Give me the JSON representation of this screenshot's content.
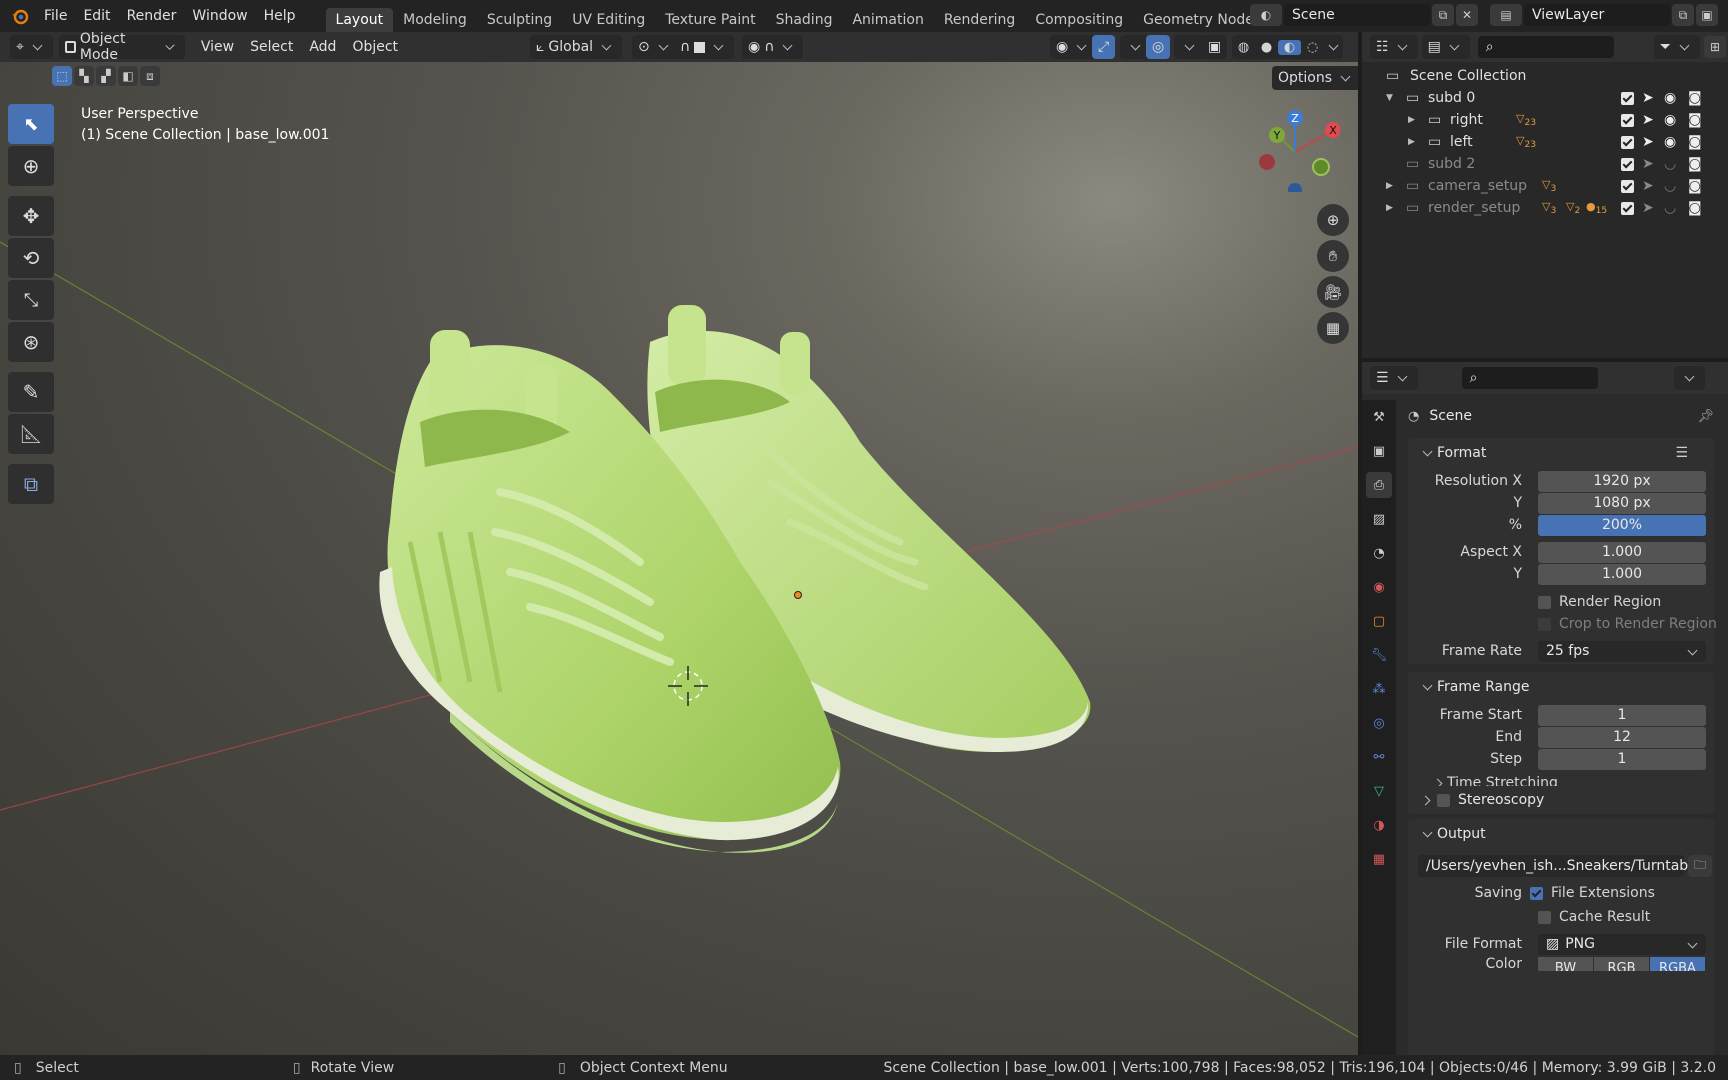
{
  "app": {
    "name": "Blender",
    "version": "3.2.0"
  },
  "menus": [
    "File",
    "Edit",
    "Render",
    "Window",
    "Help"
  ],
  "workspaces": [
    "Layout",
    "Modeling",
    "Sculpting",
    "UV Editing",
    "Texture Paint",
    "Shading",
    "Animation",
    "Rendering",
    "Compositing",
    "Geometry Nodes"
  ],
  "active_workspace": "Layout",
  "scene": {
    "name": "Scene",
    "view_layer": "ViewLayer"
  },
  "viewport_header": {
    "mode": "Object Mode",
    "menus": [
      "View",
      "Select",
      "Add",
      "Object"
    ],
    "transform_orientation": "Global",
    "options_label": "Options"
  },
  "viewport": {
    "view_name": "User Perspective",
    "context": "(1) Scene Collection | base_low.001",
    "gizmo": {
      "x": "X",
      "y": "Y",
      "z": "Z"
    },
    "colors": {
      "shoe": "#b9e07c",
      "sole": "#e6ecd6",
      "x_axis": "#c0484c",
      "y_axis": "#6b8f2e"
    }
  },
  "outliner": {
    "root": "Scene Collection",
    "items": [
      {
        "name": "subd 0",
        "expanded": true,
        "enabled": true
      },
      {
        "name": "right",
        "badge": "23",
        "enabled": true
      },
      {
        "name": "left",
        "badge": "23",
        "enabled": true
      },
      {
        "name": "subd 2",
        "enabled": true,
        "dim": true
      },
      {
        "name": "camera_setup",
        "badge": "3",
        "enabled": true,
        "dim": true
      },
      {
        "name": "render_setup",
        "badge": "3",
        "badge2": "2",
        "badge3": "15",
        "enabled": true,
        "dim": true
      }
    ]
  },
  "properties": {
    "context": "Scene",
    "format": {
      "title": "Format",
      "resolution_x_label": "Resolution X",
      "resolution_x": "1920 px",
      "y_label": "Y",
      "resolution_y": "1080 px",
      "percent_label": "%",
      "percent": "200%",
      "percent_fraction": 1.0,
      "aspect_x_label": "Aspect X",
      "aspect_x": "1.000",
      "aspect_y": "1.000",
      "render_region": "Render Region",
      "render_region_on": false,
      "crop": "Crop to Render Region",
      "crop_on": false,
      "frame_rate_label": "Frame Rate",
      "frame_rate": "25 fps"
    },
    "frame_range": {
      "title": "Frame Range",
      "start_label": "Frame Start",
      "start": "1",
      "end_label": "End",
      "end": "12",
      "step_label": "Step",
      "step": "1",
      "time_stretching": "Time Stretching"
    },
    "stereoscopy": "Stereoscopy",
    "output": {
      "title": "Output",
      "path": "/Users/yevhen_ish...Sneakers/Turntable/",
      "saving_label": "Saving",
      "file_extensions": "File Extensions",
      "file_extensions_on": true,
      "cache_result": "Cache Result",
      "cache_result_on": false,
      "file_format_label": "File Format",
      "file_format": "PNG",
      "color_label": "Color",
      "color_options": [
        "BW",
        "RGB",
        "RGBA"
      ],
      "color_selected": "RGBA"
    }
  },
  "statusbar": {
    "select": "Select",
    "rotate": "Rotate View",
    "context_menu": "Object Context Menu",
    "stats": "Scene Collection | base_low.001 | Verts:100,798 | Faces:98,052 | Tris:196,104 | Objects:0/46 | Memory: 3.99 GiB | 3.2.0"
  }
}
